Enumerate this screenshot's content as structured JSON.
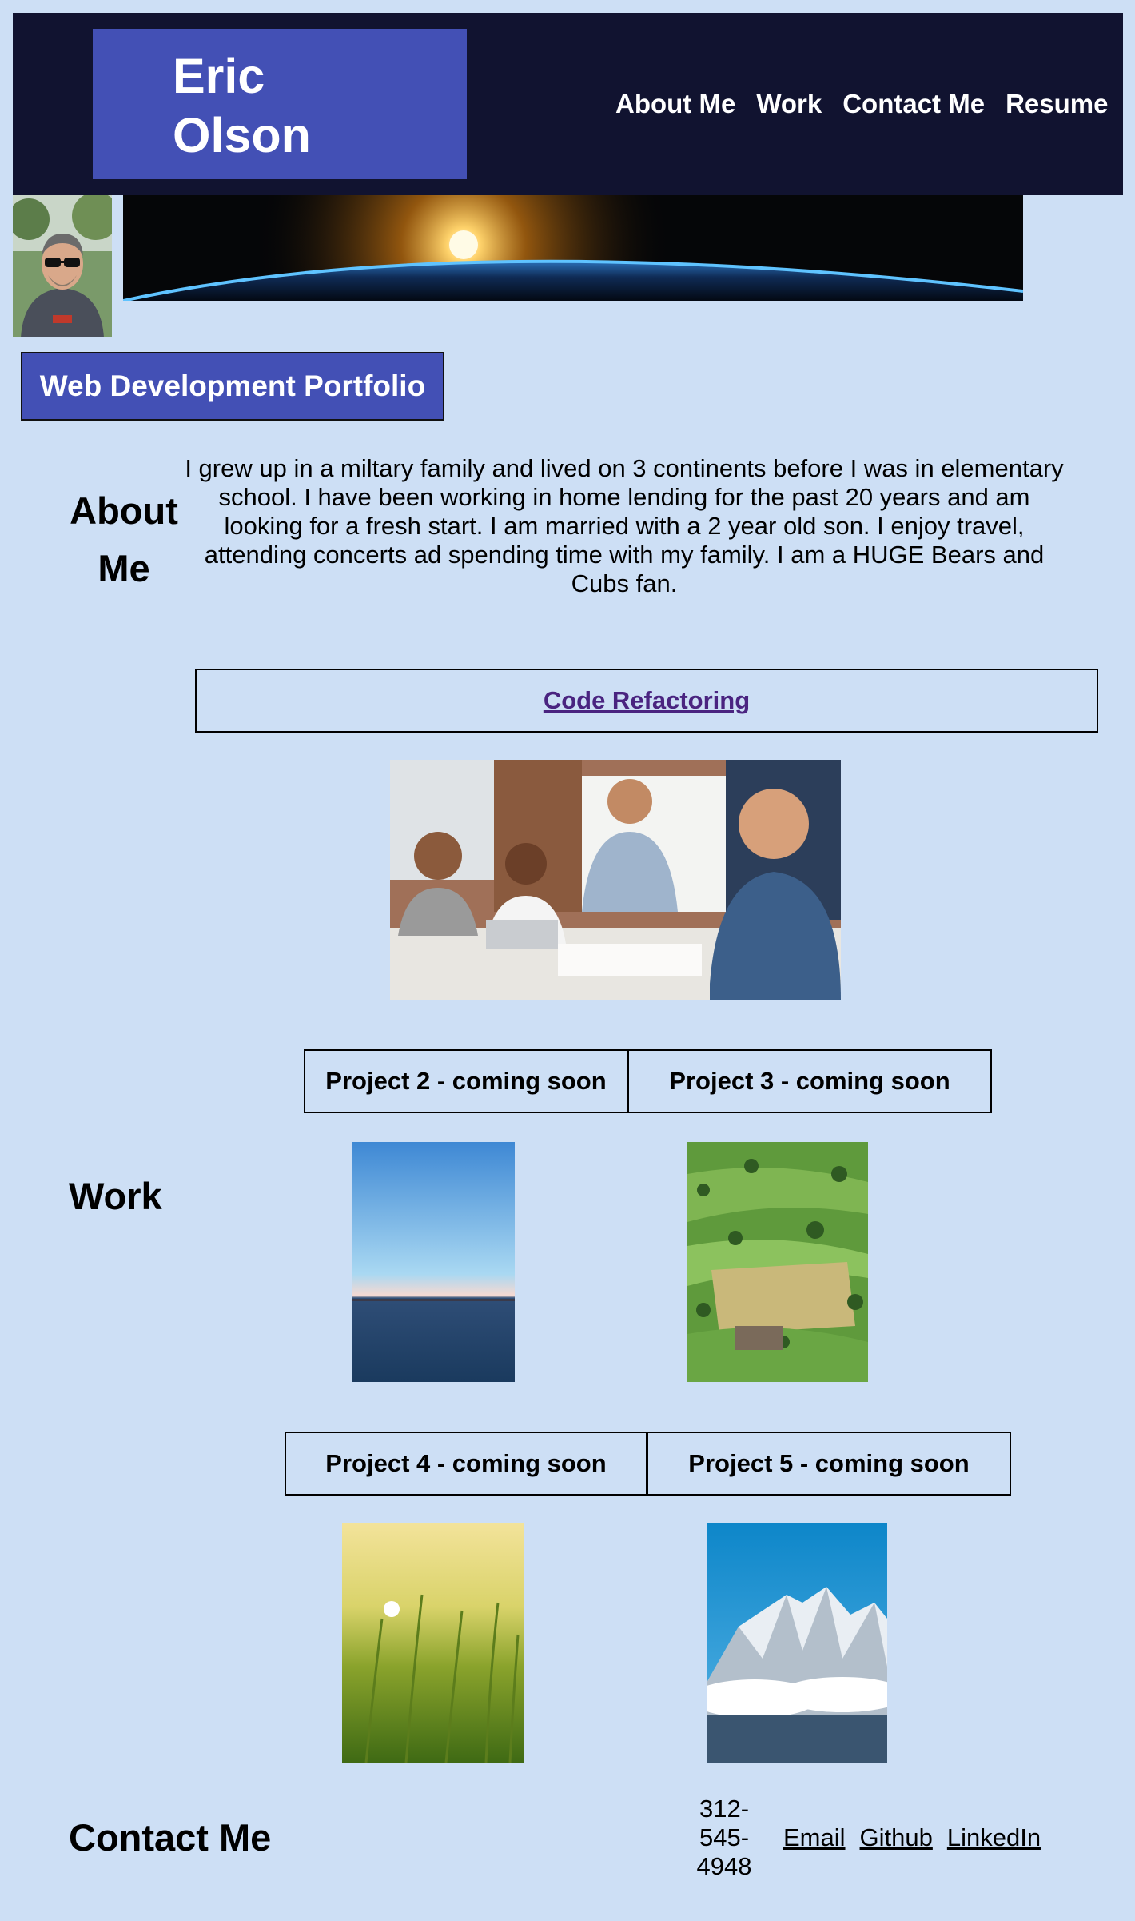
{
  "header": {
    "name_line1": "Eric",
    "name_line2": "Olson",
    "nav": [
      {
        "label": "About Me"
      },
      {
        "label": "Work"
      },
      {
        "label": "Contact Me"
      },
      {
        "label": "Resume"
      }
    ]
  },
  "portfolio_badge": "Web Development Portfolio",
  "about": {
    "heading_line1": "About",
    "heading_line2": "Me",
    "text": "I grew up in a miltary family and lived on 3 continents before I was in elementary school. I have been working in home lending for the past 20 years and am looking for a fresh start. I am married with a 2 year old son. I enjoy travel, attending concerts ad spending time with my family. I am a HUGE Bears and Cubs fan."
  },
  "work": {
    "heading": "Work",
    "featured_link": "Code Refactoring",
    "projects": [
      {
        "label": "Project 2 - coming soon"
      },
      {
        "label": "Project 3 - coming soon"
      },
      {
        "label": "Project 4 - coming soon"
      },
      {
        "label": "Project 5 - coming soon"
      }
    ]
  },
  "contact": {
    "heading": "Contact Me",
    "phone_line1": "312-",
    "phone_line2": "545-",
    "phone_line3": "4948",
    "links": [
      {
        "label": "Email"
      },
      {
        "label": "Github"
      },
      {
        "label": "LinkedIn"
      }
    ]
  },
  "colors": {
    "page_bg": "#cddff5",
    "header_bg": "#111330",
    "accent": "#4350b5",
    "link_visited": "#4a2480"
  }
}
